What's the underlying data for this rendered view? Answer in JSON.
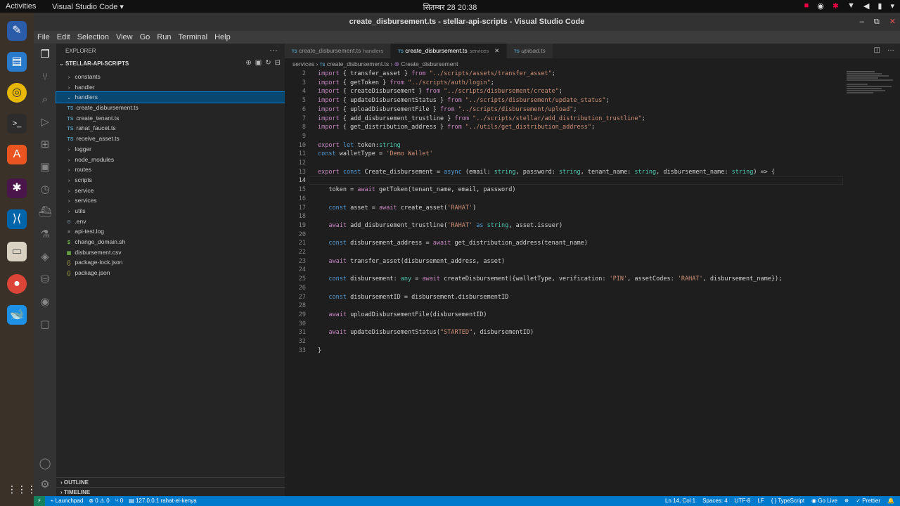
{
  "topbar": {
    "activities": "Activities",
    "app": "Visual Studio Code ▾",
    "clock": "सितम्बर 28  20:38"
  },
  "window": {
    "title": "create_disbursement.ts - stellar-api-scripts - Visual Studio Code"
  },
  "menu": [
    "File",
    "Edit",
    "Selection",
    "View",
    "Go",
    "Run",
    "Terminal",
    "Help"
  ],
  "sidebar": {
    "header": "EXPLORER",
    "project": "STELLAR-API-SCRIPTS",
    "tree": [
      {
        "label": "constants",
        "kind": "folder",
        "depth": 1
      },
      {
        "label": "handler",
        "kind": "folder",
        "depth": 1
      },
      {
        "label": "handlers",
        "kind": "folder-open",
        "depth": 1,
        "selected": true
      },
      {
        "label": "create_disbursement.ts",
        "kind": "ts",
        "depth": 2
      },
      {
        "label": "create_tenant.ts",
        "kind": "ts",
        "depth": 2
      },
      {
        "label": "rahat_faucet.ts",
        "kind": "ts",
        "depth": 2
      },
      {
        "label": "receive_asset.ts",
        "kind": "ts",
        "depth": 2
      },
      {
        "label": "logger",
        "kind": "folder",
        "depth": 1
      },
      {
        "label": "node_modules",
        "kind": "folder",
        "depth": 1
      },
      {
        "label": "routes",
        "kind": "folder",
        "depth": 1
      },
      {
        "label": "scripts",
        "kind": "folder",
        "depth": 1
      },
      {
        "label": "service",
        "kind": "folder",
        "depth": 1
      },
      {
        "label": "services",
        "kind": "folder",
        "depth": 1
      },
      {
        "label": "utils",
        "kind": "folder",
        "depth": 1
      },
      {
        "label": ".env",
        "kind": "gear",
        "depth": 1
      },
      {
        "label": "api-test.log",
        "kind": "lines",
        "depth": 1
      },
      {
        "label": "change_domain.sh",
        "kind": "dollar",
        "depth": 1
      },
      {
        "label": "disbursement.csv",
        "kind": "csv",
        "depth": 1
      },
      {
        "label": "package-lock.json",
        "kind": "json",
        "depth": 1
      },
      {
        "label": "package.json",
        "kind": "json",
        "depth": 1
      }
    ],
    "outline": "OUTLINE",
    "timeline": "TIMELINE"
  },
  "tabs": [
    {
      "label": "create_disbursement.ts",
      "desc": "handlers",
      "active": false,
      "italic": false
    },
    {
      "label": "create_disbursement.ts",
      "desc": "services",
      "active": true,
      "italic": false
    },
    {
      "label": "upload.ts",
      "desc": "",
      "active": false,
      "italic": true
    }
  ],
  "tab_prefix": "TS",
  "breadcrumb": {
    "folder": "services",
    "file": "create_disbursement.ts",
    "symbol": "Create_disbursement"
  },
  "code": [
    {
      "n": "2",
      "t": "import { transfer_asset } from \"../scripts/assets/transfer_asset\";"
    },
    {
      "n": "3",
      "t": "import { getToken } from \"../scripts/auth/login\";"
    },
    {
      "n": "4",
      "t": "import { createDisbursement } from \"../scripts/disbursement/create\";"
    },
    {
      "n": "5",
      "t": "import { updateDisbursementStatus } from \"../scripts/disbursement/update_status\";"
    },
    {
      "n": "6",
      "t": "import { uploadDisbursementFile } from \"../scripts/disbursement/upload\";"
    },
    {
      "n": "7",
      "t": "import { add_disbursement_trustline } from \"../scripts/stellar/add_distribution_trustline\";"
    },
    {
      "n": "8",
      "t": "import { get_distribution_address } from \"../utils/get_distribution_address\";"
    },
    {
      "n": "9",
      "t": ""
    },
    {
      "n": "10",
      "t": "export let token:string"
    },
    {
      "n": "11",
      "t": "const walletType = 'Demo Wallet'"
    },
    {
      "n": "12",
      "t": ""
    },
    {
      "n": "13",
      "t": "export const Create_disbursement = async (email: string, password: string, tenant_name: string, disbursement_name: string) => {"
    },
    {
      "n": "14",
      "t": ""
    },
    {
      "n": "15",
      "t": "   token = await getToken(tenant_name, email, password)"
    },
    {
      "n": "16",
      "t": ""
    },
    {
      "n": "17",
      "t": "   const asset = await create_asset('RAHAT')"
    },
    {
      "n": "18",
      "t": ""
    },
    {
      "n": "19",
      "t": "   await add_disbursement_trustline('RAHAT' as string, asset.issuer)"
    },
    {
      "n": "20",
      "t": ""
    },
    {
      "n": "21",
      "t": "   const disbursement_address = await get_distribution_address(tenant_name)"
    },
    {
      "n": "22",
      "t": ""
    },
    {
      "n": "23",
      "t": "   await transfer_asset(disbursement_address, asset)"
    },
    {
      "n": "24",
      "t": ""
    },
    {
      "n": "25",
      "t": "   const disbursement: any = await createDisbursement({walletType, verification: 'PIN', assetCodes: 'RAHAT', disbursement_name});"
    },
    {
      "n": "26",
      "t": ""
    },
    {
      "n": "27",
      "t": "   const disbursementID = disbursement.disbursementID"
    },
    {
      "n": "28",
      "t": ""
    },
    {
      "n": "29",
      "t": "   await uploadDisbursementFile(disbursementID)"
    },
    {
      "n": "30",
      "t": ""
    },
    {
      "n": "31",
      "t": "   await updateDisbursementStatus(\"STARTED\", disbursementID)"
    },
    {
      "n": "32",
      "t": ""
    },
    {
      "n": "33",
      "t": "}"
    }
  ],
  "status": {
    "remote": "⚡",
    "launchpad": "Launchpad",
    "errors": "⊗ 0 ⚠ 0",
    "ports": "⑂ 0",
    "host": "127.0.0.1  rahat-el-kenya",
    "pos": "Ln 14, Col 1",
    "spaces": "Spaces: 4",
    "enc": "UTF-8",
    "eol": "LF",
    "lang": "{ } TypeScript",
    "live": "Go Live",
    "prettier": "✓ Prettier"
  },
  "colors": {
    "accent": "#007acc",
    "selection": "#094771"
  }
}
